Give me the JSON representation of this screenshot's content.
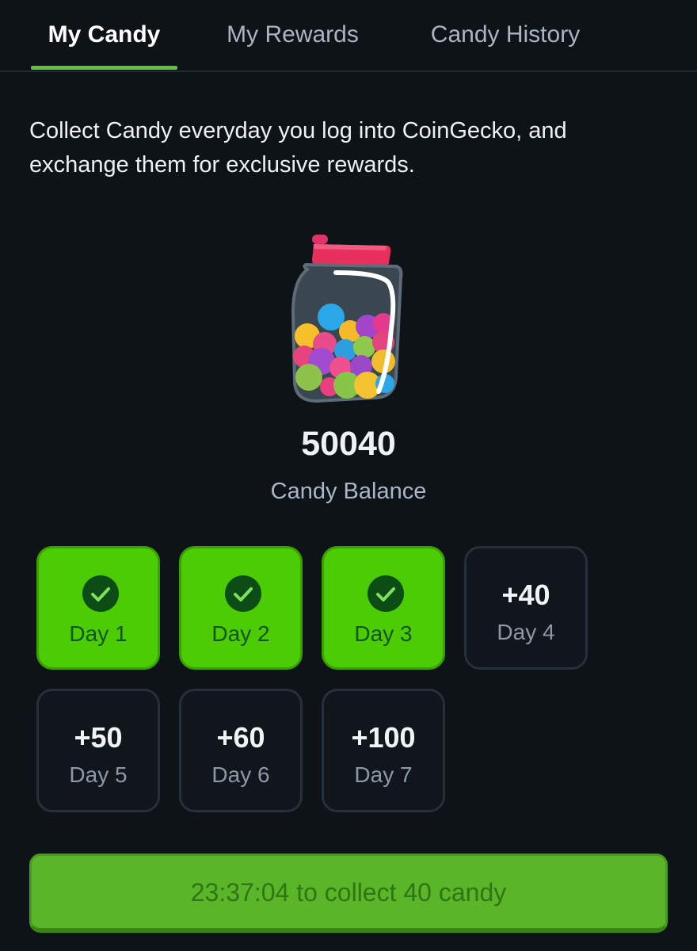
{
  "tabs": [
    {
      "label": "My Candy",
      "active": true
    },
    {
      "label": "My Rewards",
      "active": false
    },
    {
      "label": "Candy History",
      "active": false
    }
  ],
  "intro": {
    "line1": "Collect Candy everyday you log into CoinGecko, and",
    "line2": "exchange them for exclusive rewards."
  },
  "balance": {
    "value": "50040",
    "label": "Candy Balance"
  },
  "days": [
    {
      "label": "Day 1",
      "reward": "",
      "collected": true
    },
    {
      "label": "Day 2",
      "reward": "",
      "collected": true
    },
    {
      "label": "Day 3",
      "reward": "",
      "collected": true
    },
    {
      "label": "Day 4",
      "reward": "+40",
      "collected": false
    },
    {
      "label": "Day 5",
      "reward": "+50",
      "collected": false
    },
    {
      "label": "Day 6",
      "reward": "+60",
      "collected": false
    },
    {
      "label": "Day 7",
      "reward": "+100",
      "collected": false
    }
  ],
  "collect_button": {
    "label": "23:37:04 to collect 40 candy"
  },
  "icons": {
    "jar": "candy-jar-icon",
    "check": "check-icon"
  },
  "colors": {
    "accent_green": "#4ccc05",
    "tab_underline": "#60c33a",
    "background": "#0e1318"
  }
}
